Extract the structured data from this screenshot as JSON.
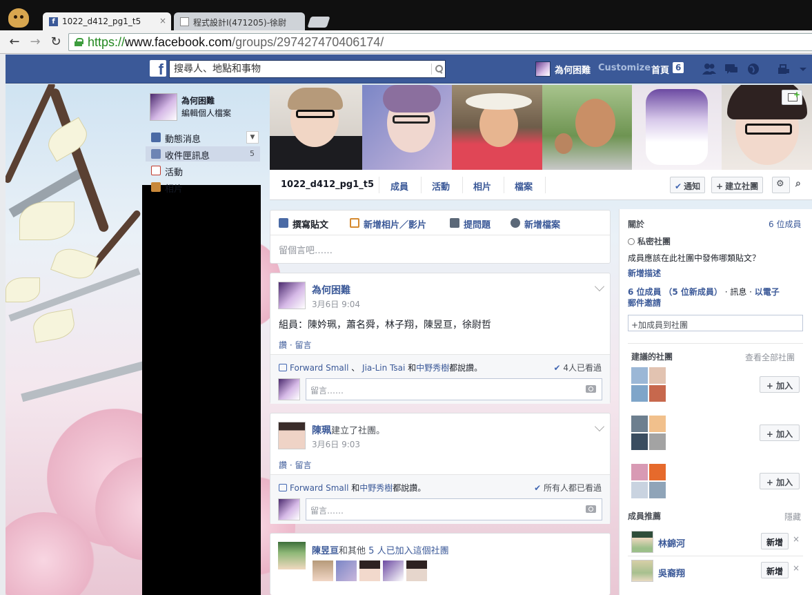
{
  "browser": {
    "tabs": [
      {
        "title": "1022_d412_pg1_t5",
        "active": true
      },
      {
        "title": "程式設計I(471205)-徐尉",
        "active": false
      }
    ],
    "url_scheme": "https://",
    "url_host": "www.facebook.com",
    "url_path": "/groups/297427470406174/",
    "close_glyph": "×",
    "back_glyph": "←",
    "forward_glyph": "→",
    "reload_glyph": "↻"
  },
  "fbbar": {
    "logo": "f",
    "search_placeholder": "搜尋人、地點和事物",
    "user_name": "為何困難",
    "customize": "Customize",
    "home": "首頁",
    "home_count": "6",
    "icons": [
      "friend-requests-icon",
      "messages-icon",
      "notifications-globe-icon",
      "privacy-icon",
      "account-caret-icon"
    ]
  },
  "leftnav": {
    "name": "為何困難",
    "edit_profile": "編輯個人檔案",
    "items": [
      {
        "label": "動態消息",
        "icon": "news-feed-icon",
        "color": "#4a6aa5"
      },
      {
        "label": "收件匣訊息",
        "icon": "messages-icon",
        "color": "#6d84b4",
        "count": "5"
      },
      {
        "label": "活動",
        "icon": "events-icon",
        "color": "#c0392b"
      },
      {
        "label": "相片",
        "icon": "photos-icon",
        "color": "#c8883a"
      }
    ]
  },
  "group": {
    "name": "1022_d412_pg1_t5",
    "tabs": [
      "成員",
      "活動",
      "相片",
      "檔案"
    ],
    "notify_label": "通知",
    "create_group_label": "建立社團",
    "check_glyph": "✔",
    "plus_glyph": "+",
    "gear_glyph": "⚙",
    "search_glyph": "⌕"
  },
  "composer": {
    "tabs": [
      {
        "label": "撰寫貼文",
        "icon": "pencil-icon",
        "color": "#4a6aa5"
      },
      {
        "label": "新增相片／影片",
        "icon": "photo-video-icon",
        "color": "#d58a30"
      },
      {
        "label": "提問題",
        "icon": "question-icon",
        "color": "#5b6878"
      },
      {
        "label": "新增檔案",
        "icon": "add-file-icon",
        "color": "#5b6878"
      }
    ],
    "placeholder": "留個言吧……"
  },
  "posts": [
    {
      "author": "為何困難",
      "action": "",
      "time": "3月6日 9:04",
      "body": "組員：陳妗珮，蕭名舜，林子翔，陳昱亘，徐尉哲",
      "links": "讚 · 留言",
      "likers_a": "Forward Small",
      "likers_sep": " 、 ",
      "likers_b": "Jia-Lin Tsai",
      "likers_and": " 和",
      "likers_c": "中野秀樹",
      "likers_tail": "都說讚。",
      "seen": "4人已看過",
      "comment_placeholder": "留言……"
    },
    {
      "author": "陳珮",
      "action": "建立了社團。",
      "time": "3月6日 9:03",
      "links": "讚 · 留言",
      "likers_a": "Forward Small",
      "likers_and": " 和",
      "likers_c": "中野秀樹",
      "likers_tail": "都說讚。",
      "seen": "所有人都已看過",
      "comment_placeholder": "留言……"
    }
  ],
  "joined": {
    "name": "陳昱亘",
    "mid": "和其他",
    "count_text": " 5 人已加入這個社團"
  },
  "right": {
    "about_title": "關於",
    "members_count": "6 位成員",
    "privacy": "私密社團",
    "question": "成員應該在此社團中發佈哪類貼文？",
    "add_desc": "新增描述",
    "members_line_a": "6 位成員",
    "members_line_b": "（5 位新成員）",
    "members_line_c": " · 訊息 · ",
    "members_line_d": "以電子",
    "members_line_e": "郵件邀請",
    "add_member_placeholder": "+加成員到社團",
    "suggested_title": "建議的社團",
    "see_all": "查看全部社團",
    "join_label": "+ 加入",
    "people_title": "成員推薦",
    "hide": "隱藏",
    "people": [
      {
        "name": "林錦河",
        "add": "新增"
      },
      {
        "name": "吳裔翔",
        "add": "新增"
      }
    ],
    "close_glyph": "×"
  }
}
